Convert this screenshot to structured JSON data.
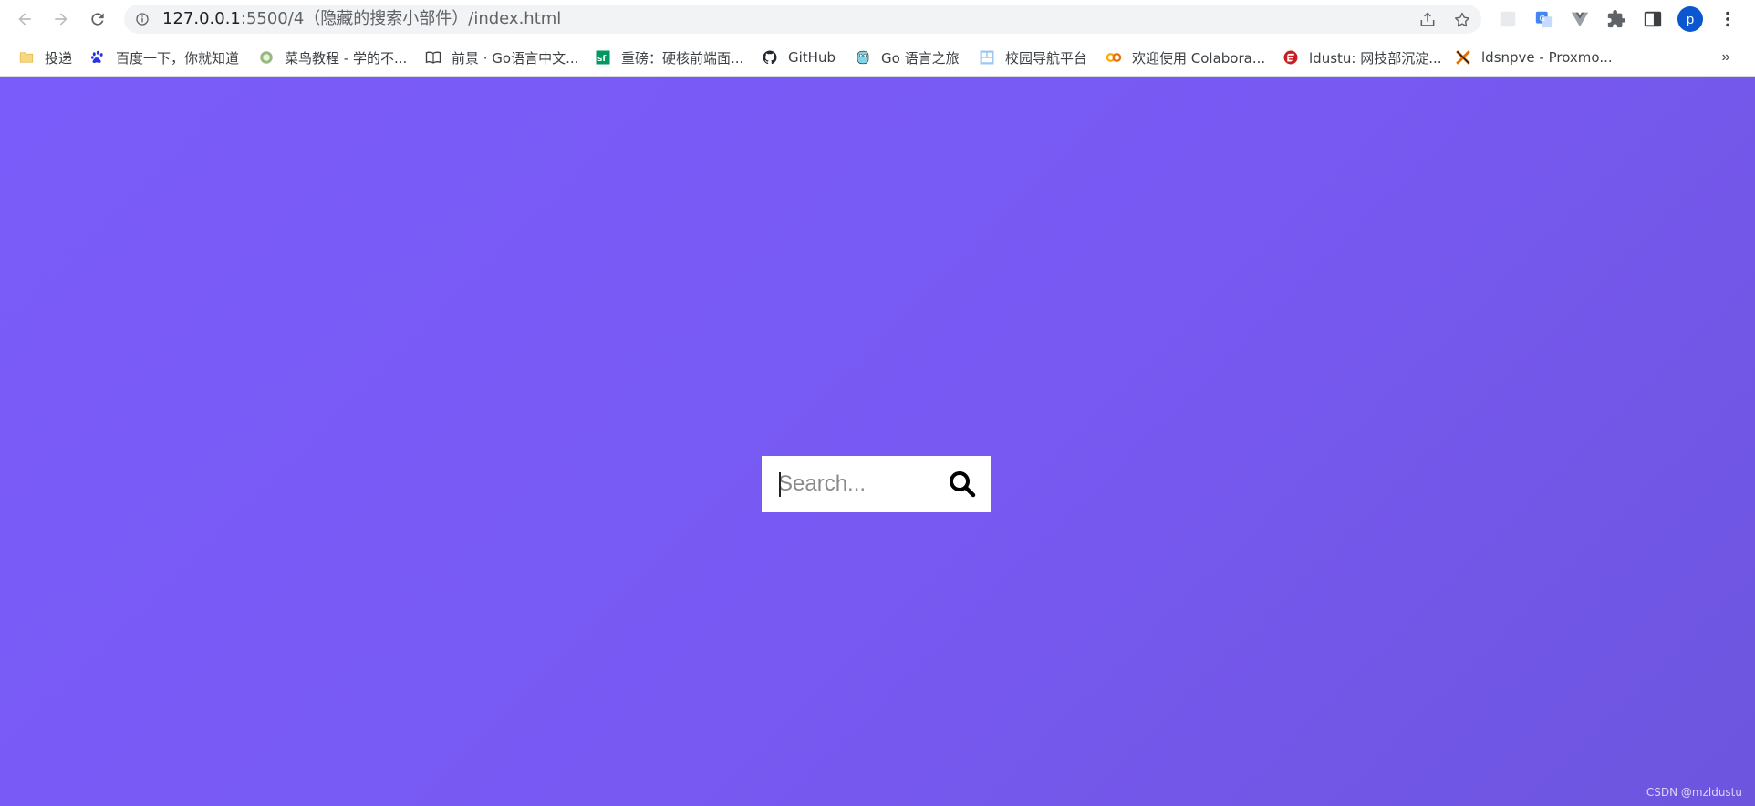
{
  "browser": {
    "url_host": "127.0.0.1",
    "url_rest": ":5500/4（隐藏的搜索小部件）/index.html",
    "profile_initial": "p"
  },
  "bookmarks": [
    {
      "label": "投递",
      "icon": "folder-icon"
    },
    {
      "label": "百度一下，你就知道",
      "icon": "baidu-icon"
    },
    {
      "label": "菜鸟教程 - 学的不...",
      "icon": "runoob-icon"
    },
    {
      "label": "前景 · Go语言中文...",
      "icon": "book-icon"
    },
    {
      "label": "重磅：硬核前端面...",
      "icon": "segmentfault-icon"
    },
    {
      "label": "GitHub",
      "icon": "github-icon"
    },
    {
      "label": "Go 语言之旅",
      "icon": "gopher-icon"
    },
    {
      "label": "校园导航平台",
      "icon": "campus-icon"
    },
    {
      "label": "欢迎使用 Colabora...",
      "icon": "colab-icon"
    },
    {
      "label": "ldustu: 网技部沉淀...",
      "icon": "gitee-icon"
    },
    {
      "label": "ldsnpve - Proxmo...",
      "icon": "proxmox-icon"
    }
  ],
  "bookmarks_overflow": "»",
  "search": {
    "placeholder": "Search...",
    "value": "",
    "button_icon": "search-icon"
  },
  "page": {
    "watermark": "CSDN @mzldustu",
    "gradient_start": "#7a5cfa",
    "gradient_end": "#6d55de"
  }
}
